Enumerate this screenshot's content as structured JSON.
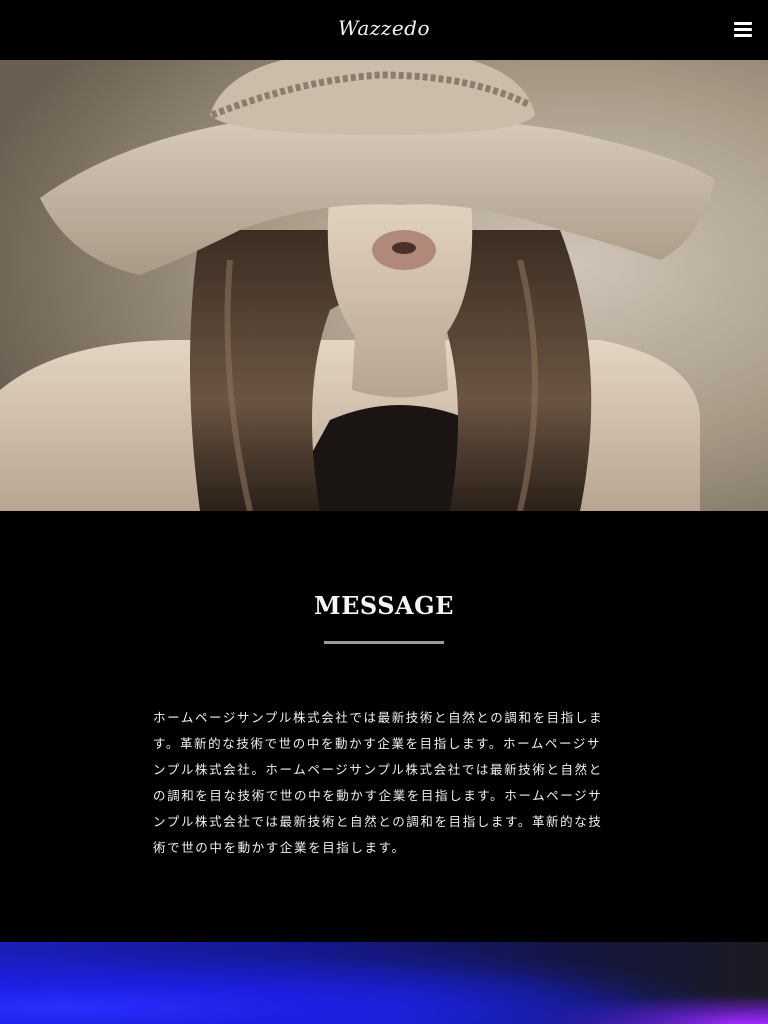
{
  "header": {
    "logo_text": "Wazzedo",
    "menu_icon": "hamburger-menu-icon"
  },
  "hero": {
    "image_subject": "",
    "palette": {
      "background": "#b5a995",
      "hat": "#cdbfae",
      "hair": "#4a3a2c",
      "skin": "#d9c9b6"
    }
  },
  "message": {
    "title": "MESSAGE",
    "body": "ホームページサンプル株式会社では最新技術と自然との調和を目指します。革新的な技術で世の中を動かす企業を目指します。ホームページサンプル株式会社。ホームページサンプル株式会社では最新技術と自然との調和を目な技術で世の中を動かす企業を目指します。ホームページサンプル株式会社では最新技術と自然との調和を目指します。革新的な技術で世の中を動かす企業を目指します。"
  },
  "colors": {
    "page_background": "#000000",
    "underline": "#9a9a9a",
    "strip_blue": "#1b1fb8",
    "strip_purple": "#a02cff"
  }
}
